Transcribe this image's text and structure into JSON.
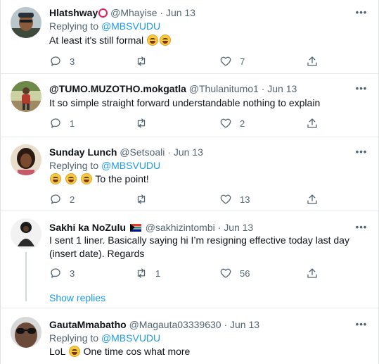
{
  "replying_prefix": "Replying to ",
  "show_replies": "Show replies",
  "more_glyph": "•••",
  "colors": {
    "link": "#1d9bf0",
    "secondary": "#536471",
    "text": "#0f1419",
    "separator": "#e6ecf0"
  },
  "tweets": [
    {
      "name": "Hlatshway",
      "handle": "@Mhayise",
      "dot": "·",
      "date": "Jun 13",
      "replying_to": "@MBSVUDU",
      "text": "At least it's still formal",
      "name_icon": "red-circle-icon",
      "emojis": [
        "face-with-tears-of-joy-icon",
        "rolling-on-floor-laughing-icon"
      ],
      "reply_count": "3",
      "retweet_count": "",
      "like_count": "7"
    },
    {
      "name": "@TUMO.MUZOTHO.mokgatla",
      "handle": "@Thulanitumo1",
      "dot": "·",
      "date": "Jun 13",
      "text": "It so simple straight forward understandable nothing to explain",
      "reply_count": "1",
      "retweet_count": "",
      "like_count": "2"
    },
    {
      "name": "Sunday Lunch",
      "handle": "@Setsoali",
      "dot": "·",
      "date": "Jun 13",
      "replying_to": "@MBSVUDU",
      "emojis": [
        "rolling-on-floor-laughing-icon",
        "rolling-on-floor-laughing-icon",
        "rolling-on-floor-laughing-icon"
      ],
      "text": " To the point!",
      "reply_count": "2",
      "retweet_count": "",
      "like_count": "13"
    },
    {
      "name": "Sakhi ka NoZulu",
      "handle": "@sakhizintombi",
      "dot": "·",
      "date": "Jun 13",
      "name_icon": "south-africa-flag-icon",
      "text": "I sent 1 liner. Basically saying hi I’m resigning effective today last day (insert date). Regards",
      "reply_count": "3",
      "retweet_count": "1",
      "like_count": "56"
    },
    {
      "name": "GautaMmabatho",
      "handle": "@Magauta03339630",
      "dot": "·",
      "date": "Jun 13",
      "replying_to": "@MBSVUDU",
      "text_before": "LoL ",
      "emojis": [
        "rolling-on-floor-laughing-icon"
      ],
      "text": " One time cos what more"
    }
  ]
}
